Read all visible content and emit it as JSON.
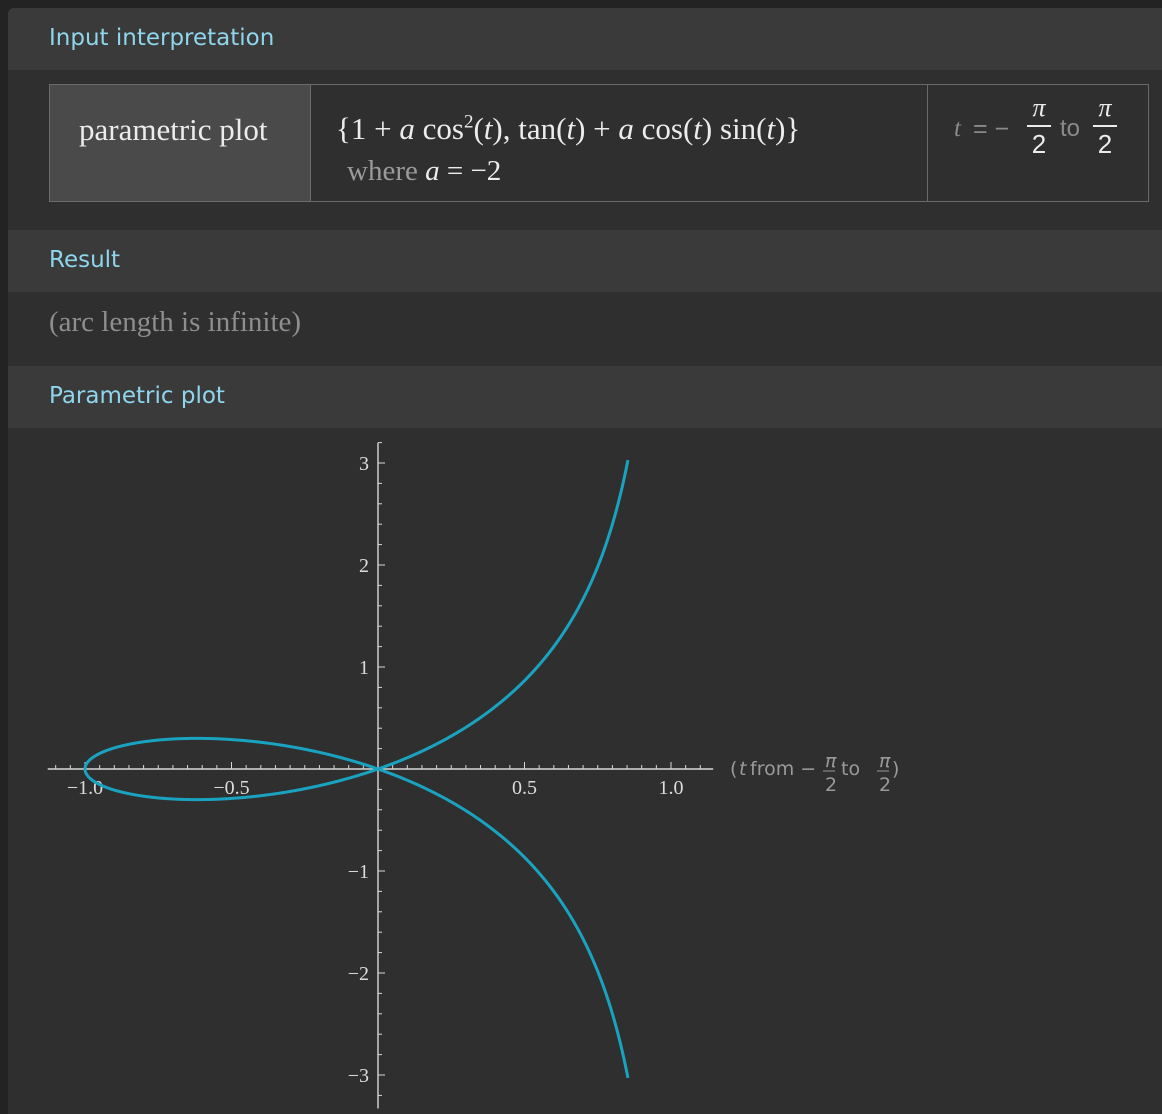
{
  "pods": {
    "input": {
      "title": "Input interpretation",
      "label": "parametric plot",
      "expr": {
        "open": "{1 + ",
        "a1": "a",
        "cos": " cos",
        "sq": "2",
        "t1open": "(",
        "t1": "t",
        "t1close": "), tan(",
        "t2": "t",
        "t2close": ") + ",
        "a2": "a",
        "cos2": " cos(",
        "t3": "t",
        "sin": ") sin(",
        "t4": "t",
        "close": ")}"
      },
      "where": {
        "word": "where ",
        "var": "a",
        "rest": " = −2"
      },
      "range": {
        "t": "t",
        "eq": " = −",
        "to": "to",
        "frac_num": "π",
        "frac_den": "2"
      }
    },
    "result": {
      "title": "Result",
      "text": "(arc length is infinite)"
    },
    "plot": {
      "title": "Parametric plot"
    }
  },
  "chart_data": {
    "type": "line",
    "title": "",
    "xlabel": "",
    "ylabel": "",
    "xlim": [
      -1.1,
      1.12
    ],
    "ylim": [
      -3.25,
      3.2
    ],
    "x_ticks": [
      "-1.0",
      "-0.5",
      "0.5",
      "1.0"
    ],
    "y_ticks": [
      "3",
      "2",
      "1",
      "-1",
      "-2",
      "-3"
    ],
    "parametric": {
      "x": "1 + a cos^2(t)",
      "y": "tan(t) + a cos(t) sin(t)",
      "a": -2,
      "t_range": [
        "-π/2",
        "π/2"
      ]
    },
    "legend": {
      "prefix": "(",
      "t": "t",
      "from": " from −",
      "to": " to ",
      "frac_num": "π",
      "frac_den": "2",
      "suffix": ")"
    },
    "series": [
      {
        "color": "#1aa3c0"
      }
    ],
    "grid": false
  }
}
